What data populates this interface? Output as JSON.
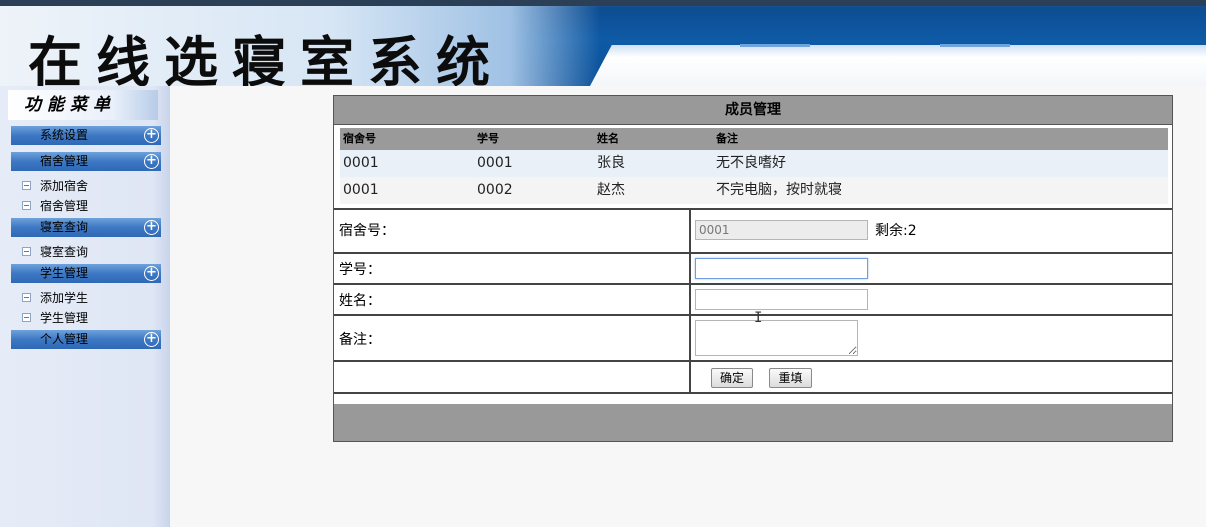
{
  "header": {
    "title": "在线选寝室系统"
  },
  "sidebar": {
    "menu_title": "功能菜单",
    "sections": [
      {
        "label": "系统设置",
        "items": []
      },
      {
        "label": "宿舍管理",
        "items": [
          "添加宿舍",
          "宿舍管理"
        ]
      },
      {
        "label": "寝室查询",
        "items": [
          "寝室查询"
        ]
      },
      {
        "label": "学生管理",
        "items": [
          "添加学生",
          "学生管理"
        ]
      },
      {
        "label": "个人管理",
        "items": []
      }
    ]
  },
  "panel": {
    "title": "成员管理",
    "members": {
      "headers": [
        "宿舍号",
        "学号",
        "姓名",
        "备注"
      ],
      "rows": [
        [
          "0001",
          "0001",
          "张良",
          "无不良嗜好"
        ],
        [
          "0001",
          "0002",
          "赵杰",
          "不完电脑，按时就寝"
        ]
      ]
    },
    "form": {
      "dorm_label": "宿舍号：",
      "dorm_value": "0001",
      "remaining": "剩余:2",
      "student_id_label": "学号：",
      "student_id_value": "",
      "name_label": "姓名：",
      "name_value": "",
      "note_label": "备注：",
      "note_value": "",
      "confirm_label": "确定",
      "reset_label": "重填"
    }
  },
  "colors": {
    "accent": "#0e5aa6",
    "menu_section": "#3d78c4",
    "panel_header": "#999999"
  }
}
